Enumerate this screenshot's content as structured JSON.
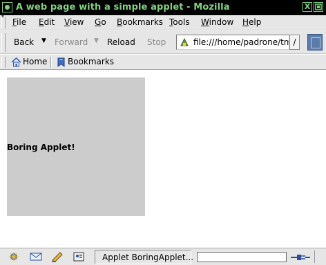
{
  "window": {
    "title": "A web page with a simple applet - Mozilla",
    "close_glyph": "X"
  },
  "menubar": {
    "items": [
      {
        "accel": "F",
        "rest": "ile"
      },
      {
        "accel": "E",
        "rest": "dit"
      },
      {
        "accel": "V",
        "rest": "iew"
      },
      {
        "accel": "G",
        "rest": "o"
      },
      {
        "accel": "B",
        "rest": "ookmarks"
      },
      {
        "accel": "T",
        "rest": "ools"
      },
      {
        "accel": "W",
        "rest": "indow"
      },
      {
        "accel": "H",
        "rest": "elp"
      }
    ]
  },
  "navbar": {
    "back_label": "Back",
    "forward_label": "Forward",
    "reload_label": "Reload",
    "stop_label": "Stop",
    "url": "file:///home/padrone/tmp",
    "url_button_label": "/"
  },
  "personalbar": {
    "home_label": "Home",
    "bookmarks_label": "Bookmarks"
  },
  "content": {
    "applet_text": "Boring Applet!",
    "applet_bg": "#cccccc"
  },
  "statusbar": {
    "text": "Applet BoringApplet..."
  },
  "colors": {
    "titlebar_bg": "#000000",
    "titlebar_fg": "#7fd37f",
    "chrome_bg": "#e6e6e6"
  }
}
